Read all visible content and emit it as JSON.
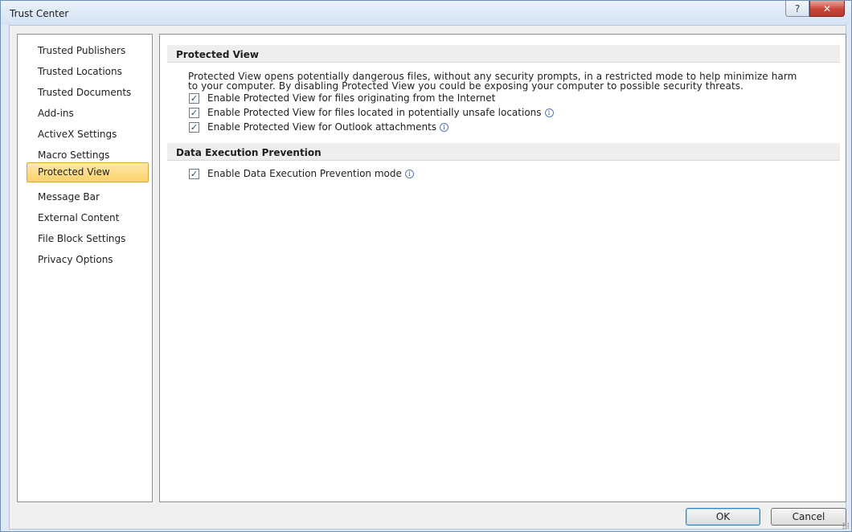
{
  "window": {
    "title": "Trust Center",
    "help_glyph": "?",
    "close_glyph": "✕"
  },
  "sidebar": {
    "items": [
      {
        "label": "Trusted Publishers",
        "active": false
      },
      {
        "label": "Trusted Locations",
        "active": false
      },
      {
        "label": "Trusted Documents",
        "active": false
      },
      {
        "label": "Add-ins",
        "active": false
      },
      {
        "label": "ActiveX Settings",
        "active": false
      },
      {
        "label": "Macro Settings",
        "active": false
      },
      {
        "label": "Protected View",
        "active": true
      },
      {
        "label": "Message Bar",
        "active": false
      },
      {
        "label": "External Content",
        "active": false
      },
      {
        "label": "File Block Settings",
        "active": false
      },
      {
        "label": "Privacy Options",
        "active": false
      }
    ]
  },
  "main": {
    "protected_view": {
      "header": "Protected View",
      "description_line1": "Protected View opens potentially dangerous files, without any security prompts, in a restricted mode to help minimize harm",
      "description_line2": "to your computer. By disabling Protected View you could be exposing your computer to possible security threats.",
      "options": [
        {
          "label": "Enable Protected View for files originating from the Internet",
          "checked": true,
          "info": false
        },
        {
          "label": "Enable Protected View for files located in potentially unsafe locations",
          "checked": true,
          "info": true
        },
        {
          "label": "Enable Protected View for Outlook attachments",
          "checked": true,
          "info": true
        }
      ]
    },
    "dep": {
      "header": "Data Execution Prevention",
      "option": {
        "label": "Enable Data Execution Prevention mode",
        "checked": true,
        "info": true
      }
    }
  },
  "footer": {
    "ok_label": "OK",
    "cancel_label": "Cancel"
  },
  "icons": {
    "check": "✓",
    "info": "i"
  }
}
